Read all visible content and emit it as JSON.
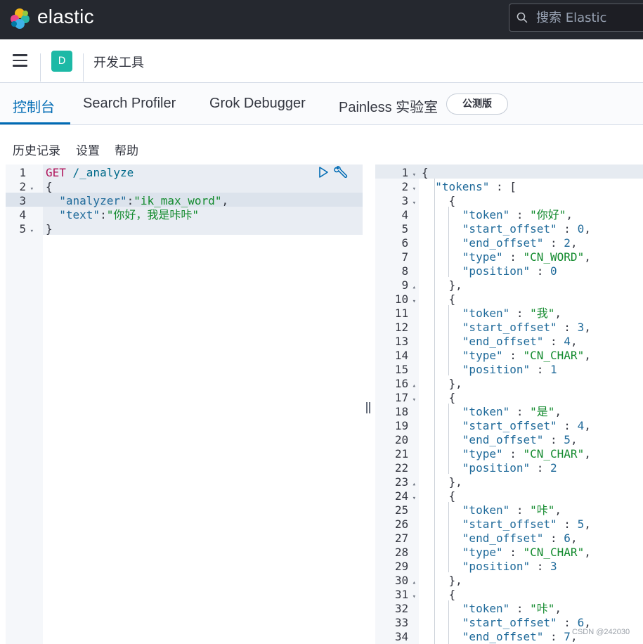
{
  "header": {
    "brand": "elastic",
    "search_placeholder": "搜索 Elastic"
  },
  "subheader": {
    "space_initial": "D",
    "page_title": "开发工具"
  },
  "tabs": [
    {
      "label": "控制台",
      "active": true
    },
    {
      "label": "Search Profiler",
      "active": false
    },
    {
      "label": "Grok Debugger",
      "active": false
    },
    {
      "label": "Painless 实验室",
      "active": false
    }
  ],
  "beta_badge": "公测版",
  "menu": {
    "history": "历史记录",
    "settings": "设置",
    "help": "帮助"
  },
  "request_editor": {
    "line_numbers": [
      "1",
      "2",
      "3",
      "4",
      "5"
    ],
    "lines": [
      [
        [
          "method",
          "GET"
        ],
        [
          "path",
          " /_analyze"
        ]
      ],
      [
        [
          "punc",
          "{"
        ]
      ],
      [
        [
          "punc",
          "  "
        ],
        [
          "key",
          "\"analyzer\""
        ],
        [
          "punc",
          ":"
        ],
        [
          "str",
          "\"ik_max_word\""
        ],
        [
          "punc",
          ","
        ]
      ],
      [
        [
          "punc",
          "  "
        ],
        [
          "key",
          "\"text\""
        ],
        [
          "punc",
          ":"
        ],
        [
          "str",
          "\"你好，我是咔咔\""
        ]
      ],
      [
        [
          "punc",
          "}"
        ]
      ]
    ],
    "fold_lines": [
      2,
      5
    ]
  },
  "response_editor": {
    "line_numbers": [
      "1",
      "2",
      "3",
      "4",
      "5",
      "6",
      "7",
      "8",
      "9",
      "10",
      "11",
      "12",
      "13",
      "14",
      "15",
      "16",
      "17",
      "18",
      "19",
      "20",
      "21",
      "22",
      "23",
      "24",
      "25",
      "26",
      "27",
      "28",
      "29",
      "30",
      "31",
      "32",
      "33",
      "34"
    ],
    "lines": [
      [
        [
          "punc",
          "{"
        ]
      ],
      [
        [
          "punc",
          "  "
        ],
        [
          "key",
          "\"tokens\""
        ],
        [
          "punc",
          " : ["
        ]
      ],
      [
        [
          "punc",
          "    {"
        ]
      ],
      [
        [
          "punc",
          "      "
        ],
        [
          "key",
          "\"token\""
        ],
        [
          "punc",
          " : "
        ],
        [
          "str",
          "\"你好\""
        ],
        [
          "punc",
          ","
        ]
      ],
      [
        [
          "punc",
          "      "
        ],
        [
          "key",
          "\"start_offset\""
        ],
        [
          "punc",
          " : "
        ],
        [
          "num",
          "0"
        ],
        [
          "punc",
          ","
        ]
      ],
      [
        [
          "punc",
          "      "
        ],
        [
          "key",
          "\"end_offset\""
        ],
        [
          "punc",
          " : "
        ],
        [
          "num",
          "2"
        ],
        [
          "punc",
          ","
        ]
      ],
      [
        [
          "punc",
          "      "
        ],
        [
          "key",
          "\"type\""
        ],
        [
          "punc",
          " : "
        ],
        [
          "str",
          "\"CN_WORD\""
        ],
        [
          "punc",
          ","
        ]
      ],
      [
        [
          "punc",
          "      "
        ],
        [
          "key",
          "\"position\""
        ],
        [
          "punc",
          " : "
        ],
        [
          "num",
          "0"
        ]
      ],
      [
        [
          "punc",
          "    },"
        ]
      ],
      [
        [
          "punc",
          "    {"
        ]
      ],
      [
        [
          "punc",
          "      "
        ],
        [
          "key",
          "\"token\""
        ],
        [
          "punc",
          " : "
        ],
        [
          "str",
          "\"我\""
        ],
        [
          "punc",
          ","
        ]
      ],
      [
        [
          "punc",
          "      "
        ],
        [
          "key",
          "\"start_offset\""
        ],
        [
          "punc",
          " : "
        ],
        [
          "num",
          "3"
        ],
        [
          "punc",
          ","
        ]
      ],
      [
        [
          "punc",
          "      "
        ],
        [
          "key",
          "\"end_offset\""
        ],
        [
          "punc",
          " : "
        ],
        [
          "num",
          "4"
        ],
        [
          "punc",
          ","
        ]
      ],
      [
        [
          "punc",
          "      "
        ],
        [
          "key",
          "\"type\""
        ],
        [
          "punc",
          " : "
        ],
        [
          "str",
          "\"CN_CHAR\""
        ],
        [
          "punc",
          ","
        ]
      ],
      [
        [
          "punc",
          "      "
        ],
        [
          "key",
          "\"position\""
        ],
        [
          "punc",
          " : "
        ],
        [
          "num",
          "1"
        ]
      ],
      [
        [
          "punc",
          "    },"
        ]
      ],
      [
        [
          "punc",
          "    {"
        ]
      ],
      [
        [
          "punc",
          "      "
        ],
        [
          "key",
          "\"token\""
        ],
        [
          "punc",
          " : "
        ],
        [
          "str",
          "\"是\""
        ],
        [
          "punc",
          ","
        ]
      ],
      [
        [
          "punc",
          "      "
        ],
        [
          "key",
          "\"start_offset\""
        ],
        [
          "punc",
          " : "
        ],
        [
          "num",
          "4"
        ],
        [
          "punc",
          ","
        ]
      ],
      [
        [
          "punc",
          "      "
        ],
        [
          "key",
          "\"end_offset\""
        ],
        [
          "punc",
          " : "
        ],
        [
          "num",
          "5"
        ],
        [
          "punc",
          ","
        ]
      ],
      [
        [
          "punc",
          "      "
        ],
        [
          "key",
          "\"type\""
        ],
        [
          "punc",
          " : "
        ],
        [
          "str",
          "\"CN_CHAR\""
        ],
        [
          "punc",
          ","
        ]
      ],
      [
        [
          "punc",
          "      "
        ],
        [
          "key",
          "\"position\""
        ],
        [
          "punc",
          " : "
        ],
        [
          "num",
          "2"
        ]
      ],
      [
        [
          "punc",
          "    },"
        ]
      ],
      [
        [
          "punc",
          "    {"
        ]
      ],
      [
        [
          "punc",
          "      "
        ],
        [
          "key",
          "\"token\""
        ],
        [
          "punc",
          " : "
        ],
        [
          "str",
          "\"咔\""
        ],
        [
          "punc",
          ","
        ]
      ],
      [
        [
          "punc",
          "      "
        ],
        [
          "key",
          "\"start_offset\""
        ],
        [
          "punc",
          " : "
        ],
        [
          "num",
          "5"
        ],
        [
          "punc",
          ","
        ]
      ],
      [
        [
          "punc",
          "      "
        ],
        [
          "key",
          "\"end_offset\""
        ],
        [
          "punc",
          " : "
        ],
        [
          "num",
          "6"
        ],
        [
          "punc",
          ","
        ]
      ],
      [
        [
          "punc",
          "      "
        ],
        [
          "key",
          "\"type\""
        ],
        [
          "punc",
          " : "
        ],
        [
          "str",
          "\"CN_CHAR\""
        ],
        [
          "punc",
          ","
        ]
      ],
      [
        [
          "punc",
          "      "
        ],
        [
          "key",
          "\"position\""
        ],
        [
          "punc",
          " : "
        ],
        [
          "num",
          "3"
        ]
      ],
      [
        [
          "punc",
          "    },"
        ]
      ],
      [
        [
          "punc",
          "    {"
        ]
      ],
      [
        [
          "punc",
          "      "
        ],
        [
          "key",
          "\"token\""
        ],
        [
          "punc",
          " : "
        ],
        [
          "str",
          "\"咔\""
        ],
        [
          "punc",
          ","
        ]
      ],
      [
        [
          "punc",
          "      "
        ],
        [
          "key",
          "\"start_offset\""
        ],
        [
          "punc",
          " : "
        ],
        [
          "num",
          "6"
        ],
        [
          "punc",
          ","
        ]
      ],
      [
        [
          "punc",
          "      "
        ],
        [
          "key",
          "\"end_offset\""
        ],
        [
          "punc",
          " : "
        ],
        [
          "num",
          "7"
        ],
        [
          "punc",
          ","
        ]
      ]
    ],
    "fold_open_lines": [
      1,
      2,
      3,
      10,
      17,
      24,
      31
    ],
    "fold_close_lines": [
      9,
      16,
      23,
      30
    ]
  },
  "watermark": "CSDN @242030"
}
